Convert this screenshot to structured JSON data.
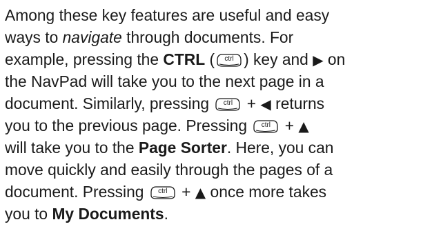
{
  "paragraph": {
    "line1": "Among these key features are useful and easy",
    "line2_a": "ways to ",
    "line2_em": "navigate",
    "line2_b": " through documents. For",
    "line3_a": "example, pressing the ",
    "line3_bold": "CTRL",
    "line3_paren_open": " (",
    "line3_paren_close": ") key and ",
    "line3_b": " on",
    "line4": "the NavPad will take you to the next page in a",
    "line5_a": "document. Similarly, pressing ",
    "line5_plus": " + ",
    "line5_b": " returns",
    "line6_a": "you to the previous page. Pressing ",
    "line6_plus": " + ",
    "line7_a": "will take you to the ",
    "line7_bold": "Page Sorter",
    "line7_b": ". Here, you can",
    "line8": "move quickly and easily through the pages of a",
    "line9_a": "document. Pressing ",
    "line9_plus": " + ",
    "line9_b": " once more takes",
    "line10_a": "you to ",
    "line10_bold": "My Documents",
    "line10_b": "."
  },
  "ctrl_key": {
    "label": "ctrl",
    "icon": "ctrl-key-icon"
  },
  "arrows": {
    "right": "▶",
    "left": "◀",
    "up": "▲"
  }
}
